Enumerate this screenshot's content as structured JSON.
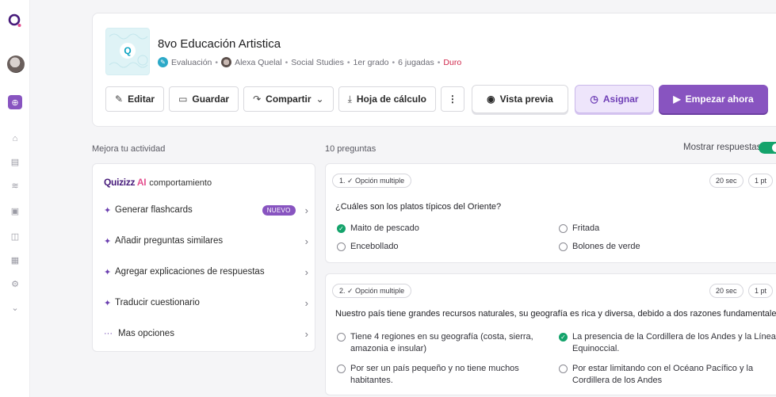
{
  "colors": {
    "brand": "#8854c0",
    "correct": "#14a36b",
    "hard": "#d0274b"
  },
  "rail": {
    "icons": [
      "quizizz-logo-icon",
      "avatar",
      "create-icon",
      "explore-icon",
      "library-icon",
      "reports-icon",
      "classes-icon",
      "accommodations-icon",
      "subscriptions-icon",
      "settings-icon",
      "more-icon"
    ]
  },
  "quiz": {
    "title": "8vo Educación Artistica",
    "type": "Evaluación",
    "author": "Alexa Quelal",
    "subject": "Social Studies",
    "grade": "1er grado",
    "plays": "6 jugadas",
    "difficulty": "Duro",
    "sep": "•"
  },
  "toolbar": {
    "edit": "Editar",
    "save": "Guardar",
    "share": "Compartir",
    "sheet": "Hoja de cálculo",
    "more": "⋮",
    "preview": "Vista previa",
    "assign": "Asignar",
    "start": "Empezar ahora"
  },
  "improve": {
    "section_label": "Mejora tu actividad",
    "brand": "Quizizz",
    "brand_ai": "AI",
    "brand_suffix": "comportamiento",
    "items": [
      {
        "label": "Generar flashcards",
        "badge": "NUEVO"
      },
      {
        "label": "Añadir preguntas similares"
      },
      {
        "label": "Agregar explicaciones de respuestas"
      },
      {
        "label": "Traducir cuestionario"
      },
      {
        "label": "Mas opciones"
      }
    ]
  },
  "questions": {
    "count_label": "10 preguntas",
    "show_answers_label": "Mostrar respuestas",
    "show_answers": true,
    "items": [
      {
        "type_label": "1. ✓ Opción multiple",
        "time": "20 sec",
        "points": "1 pt",
        "text": "¿Cuáles son los platos típicos del Oriente?",
        "options": [
          {
            "text": "Maito de pescado",
            "correct": true
          },
          {
            "text": "Fritada",
            "correct": false
          },
          {
            "text": "Encebollado",
            "correct": false
          },
          {
            "text": "Bolones de verde",
            "correct": false
          }
        ]
      },
      {
        "type_label": "2. ✓ Opción multiple",
        "time": "20 sec",
        "points": "1 pt",
        "text": "Nuestro país tiene grandes recursos naturales, su geografía es rica y diversa, debido a dos razones fundamentales:",
        "options": [
          {
            "text": "Tiene 4 regiones en su geografía (costa, sierra, amazonia e insular)",
            "correct": false
          },
          {
            "text": "La presencia de la Cordillera de los Andes y la Línea Equinoccial.",
            "correct": true
          },
          {
            "text": "Por ser un país pequeño y no tiene muchos habitantes.",
            "correct": false
          },
          {
            "text": "Por estar limitando con el Océano Pacífico y la Cordillera de los Andes",
            "correct": false
          }
        ]
      }
    ]
  }
}
